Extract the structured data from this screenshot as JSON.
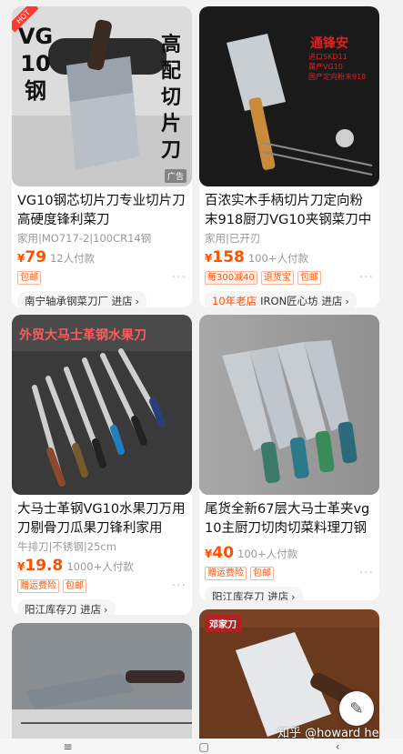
{
  "products": [
    {
      "title": "VG10钢芯切片刀专业切片刀高硬度锋利菜刀",
      "meta": "家用|MO717-2|100CR14钢",
      "yen": "¥",
      "price": "79",
      "paid": "12人付款",
      "tags": [
        "包邮"
      ],
      "shop_prefix": "",
      "shop": "南宁轴承钢菜刀厂 进店",
      "image_text": {
        "left": "VG\n10\n钢",
        "right": "高\n配\n切\n片\n刀",
        "hot": "HOT",
        "ad": "广告"
      }
    },
    {
      "title": "百浓实木手柄切片刀定向粉末918厨刀VG10夹钢菜刀中",
      "meta": "家用|已开刃",
      "yen": "¥",
      "price": "158",
      "paid": "100+人付款",
      "tags": [
        "每300减40",
        "退货宝",
        "包邮"
      ],
      "shop_prefix": "10年老店",
      "shop": "IRON匠心坊 进店",
      "image_text": {
        "stamp": "通锋安",
        "lines": "进口SKD11\n属产VG10\n国产定向粉末918"
      }
    },
    {
      "title": "大马士革钢VG10水果刀万用刀剔骨刀瓜果刀锋利家用",
      "meta": "牛排刀|不锈钢|25cm",
      "yen": "¥",
      "price": "19.8",
      "paid": "1000+人付款",
      "tags": [
        "赠运费险",
        "包邮"
      ],
      "shop_prefix": "",
      "shop": "阳江库存刀 进店",
      "image_text": {
        "banner": "外贸大马士革钢水果刀"
      }
    },
    {
      "title": "尾货全新67层大马士革夹vg10主厨刀切肉切菜料理刀钢",
      "meta": "",
      "yen": "¥",
      "price": "40",
      "paid": "100+人付款",
      "tags": [
        "赠运费险",
        "包邮"
      ],
      "shop_prefix": "",
      "shop": "阳江库存刀 进店",
      "image_text": {}
    },
    {
      "title": "",
      "image_text": {}
    },
    {
      "title": "",
      "image_text": {
        "logo": "邓家刀"
      }
    }
  ],
  "fab_icon": "edit-icon",
  "watermark": "知乎 @howard he",
  "colors": {
    "accent": "#ff5000",
    "bg": "#f2f2f2"
  }
}
